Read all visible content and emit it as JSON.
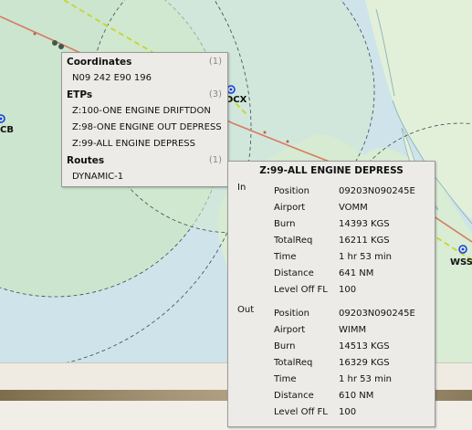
{
  "map": {
    "stations": [
      {
        "id": "CB"
      },
      {
        "id": "DCX"
      },
      {
        "id": "WSS"
      }
    ],
    "colors": {
      "land": "#dbeed6",
      "range_area": "#cfe8cc",
      "sea": "#cfe3ea",
      "route": "#d97a62",
      "dashed_route": "#c6d62a",
      "station": "#1a3fe0"
    }
  },
  "menu": {
    "coordinates": {
      "title": "Coordinates",
      "count": "(1)",
      "items": [
        "N09 242 E90 196"
      ]
    },
    "etps": {
      "title": "ETPs",
      "count": "(3)",
      "items": [
        "Z:100-ONE ENGINE DRIFTDON",
        "Z:98-ONE ENGINE OUT DEPRESS",
        "Z:99-ALL ENGINE DEPRESS"
      ]
    },
    "routes": {
      "title": "Routes",
      "count": "(1)",
      "items": [
        "DYNAMIC-1"
      ]
    }
  },
  "etp_detail": {
    "title": "Z:99-ALL ENGINE DEPRESS",
    "in": {
      "label": "In",
      "rows": [
        {
          "key": "Position",
          "value": "09203N090245E"
        },
        {
          "key": "Airport",
          "value": "VOMM"
        },
        {
          "key": "Burn",
          "value": "14393 KGS"
        },
        {
          "key": "TotalReq",
          "value": "16211 KGS"
        },
        {
          "key": "Time",
          "value": "1 hr 53 min"
        },
        {
          "key": "Distance",
          "value": "641 NM"
        },
        {
          "key": "Level Off FL",
          "value": "100"
        }
      ]
    },
    "out": {
      "label": "Out",
      "rows": [
        {
          "key": "Position",
          "value": "09203N090245E"
        },
        {
          "key": "Airport",
          "value": "WIMM"
        },
        {
          "key": "Burn",
          "value": "14513 KGS"
        },
        {
          "key": "TotalReq",
          "value": "16329 KGS"
        },
        {
          "key": "Time",
          "value": "1 hr 53 min"
        },
        {
          "key": "Distance",
          "value": "610 NM"
        },
        {
          "key": "Level Off FL",
          "value": "100"
        }
      ]
    }
  }
}
